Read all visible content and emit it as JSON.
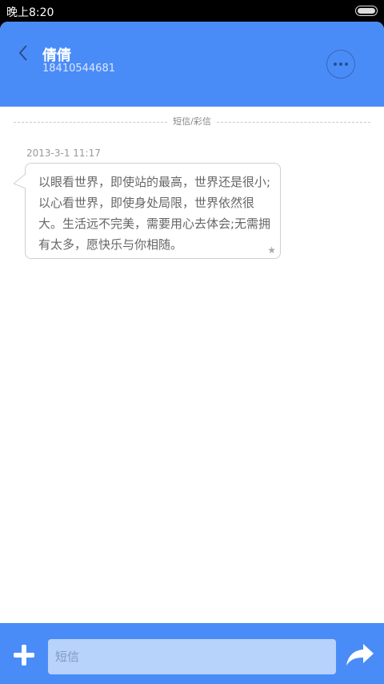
{
  "status_bar": {
    "time": "晚上8:20"
  },
  "header": {
    "contact_name": "倩倩",
    "contact_number": "18410544681"
  },
  "divider": {
    "label": "短信/彩信"
  },
  "messages": [
    {
      "timestamp": "2013-3-1 11:17",
      "text": "以眼看世界，即使站的最高，世界还是很小;以心看世界，即使身处局限，世界依然很大。生活远不完美，需要用心去体会;无需拥有太多，愿快乐与你相随。",
      "starred": true
    }
  ],
  "composer": {
    "placeholder": "短信"
  },
  "colors": {
    "accent": "#4a8cf7",
    "input_bg": "#b7d2fb"
  }
}
